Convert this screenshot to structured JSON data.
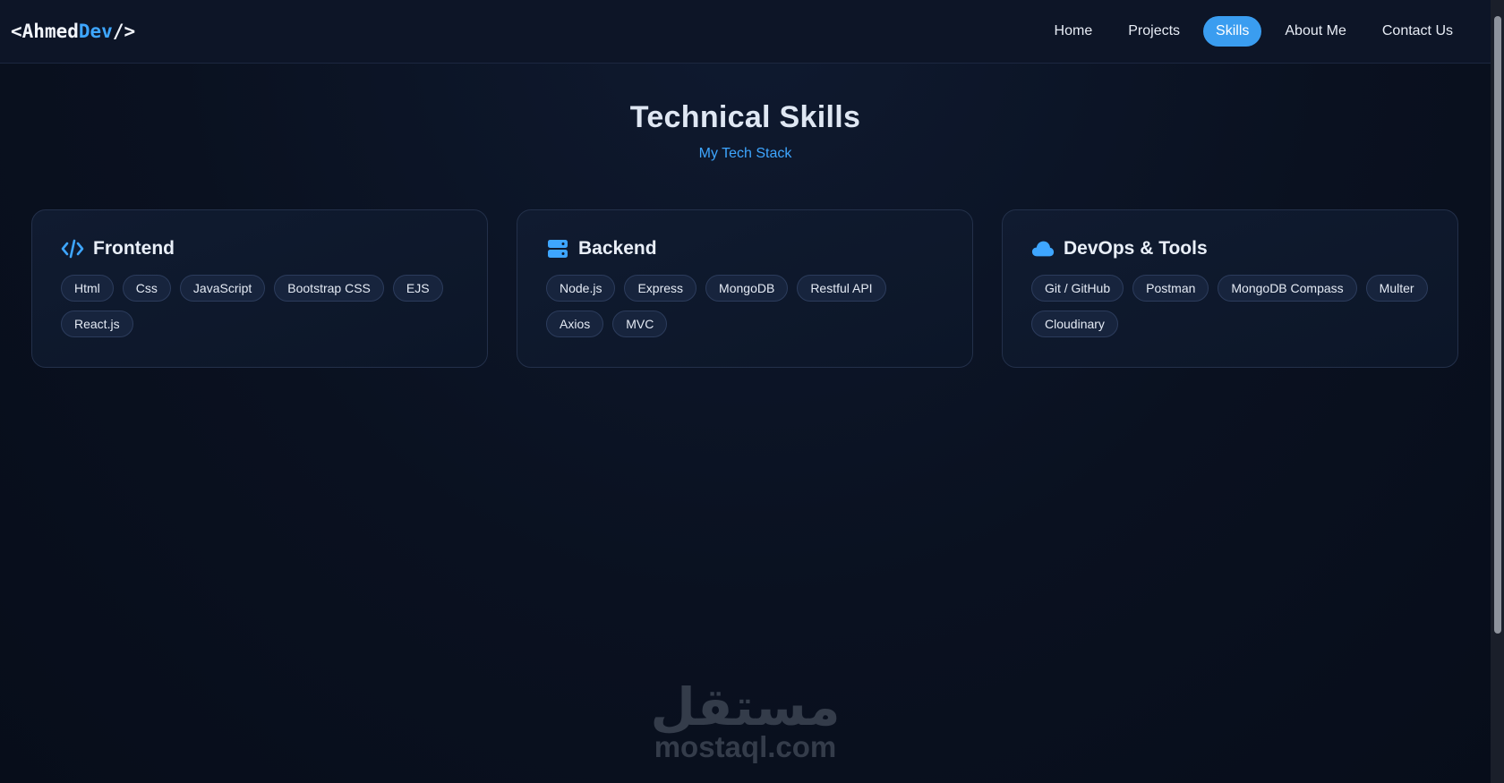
{
  "brand": {
    "open": "<",
    "name": "Ahmed",
    "accent": "Dev",
    "close": "/>"
  },
  "nav": {
    "items": [
      {
        "label": "Home"
      },
      {
        "label": "Projects"
      },
      {
        "label": "Skills",
        "active": true
      },
      {
        "label": "About Me"
      },
      {
        "label": "Contact Us"
      }
    ]
  },
  "hero": {
    "title": "Technical Skills",
    "subtitle": "My Tech Stack"
  },
  "cards": [
    {
      "title": "Frontend",
      "icon": "code-icon",
      "skills": [
        "Html",
        "Css",
        "JavaScript",
        "Bootstrap CSS",
        "EJS",
        "React.js"
      ]
    },
    {
      "title": "Backend",
      "icon": "server-icon",
      "skills": [
        "Node.js",
        "Express",
        "MongoDB",
        "Restful API",
        "Axios",
        "MVC"
      ]
    },
    {
      "title": "DevOps & Tools",
      "icon": "cloud-icon",
      "skills": [
        "Git / GitHub",
        "Postman",
        "MongoDB Compass",
        "Multer",
        "Cloudinary"
      ]
    }
  ],
  "watermark": {
    "arabic": "مستقل",
    "latin": "mostaql.com"
  },
  "colors": {
    "accent": "#3ea6ff",
    "active_nav": "#3a9df0",
    "background": "#0b1120"
  }
}
